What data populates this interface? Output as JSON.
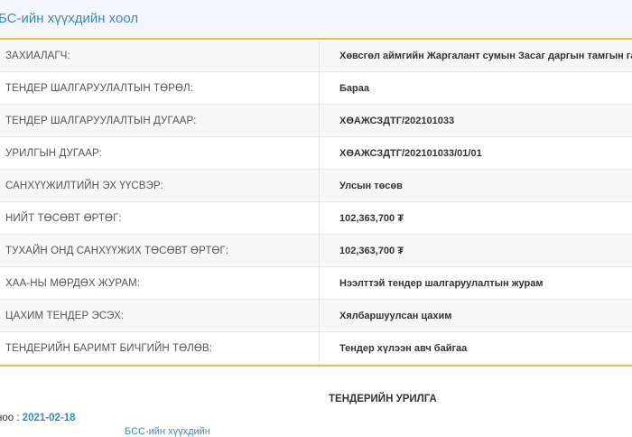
{
  "header": {
    "title": "БС-ийн хүүхдийн хоол"
  },
  "rows": [
    {
      "label": "ЗАХИАЛАГЧ:",
      "value": "Хөвсгөл аймгийн Жаргалант сумын Засаг даргын тамгын газар"
    },
    {
      "label": "ТЕНДЕР ШАЛГАРУУЛАЛТЫН ТӨРӨЛ:",
      "value": "Бараа"
    },
    {
      "label": "ТЕНДЕР ШАЛГАРУУЛАЛТЫН ДУГААР:",
      "value": "ХӨАЖСЗДТГ/202101033"
    },
    {
      "label": "УРИЛГЫН ДУГААР:",
      "value": "ХӨАЖСЗДТГ/202101033/01/01"
    },
    {
      "label": "САНХҮҮЖИЛТИЙН ЭХ ҮҮСВЭР:",
      "value": "Улсын төсөв"
    },
    {
      "label": "НИЙТ ТӨСӨВТ ӨРТӨГ:",
      "value": "102,363,700 ₮"
    },
    {
      "label": "ТУХАЙН ОНД САНХҮҮЖИХ ТӨСӨВТ ӨРТӨГ:",
      "value": "102,363,700 ₮"
    },
    {
      "label": "ХАА-НЫ МӨРДӨХ ЖУРАМ:",
      "value": "Нээлттэй тендер шалгаруулалтын журам"
    },
    {
      "label": "ЦАХИМ ТЕНДЕР ЭСЭХ:",
      "value": "Хялбаршуулсан цахим"
    },
    {
      "label": "ТЕНДЕРИЙН БАРИМТ БИЧГИЙН ТӨЛӨВ:",
      "value": "Тендер хүлээн авч байгаа"
    }
  ],
  "invitation": {
    "title": "ТЕНДЕРИЙН УРИЛГА",
    "date_label": "ноо : ",
    "date_value": "2021-02-18",
    "cut_text": "БСС-ийн хүүхдийн"
  }
}
